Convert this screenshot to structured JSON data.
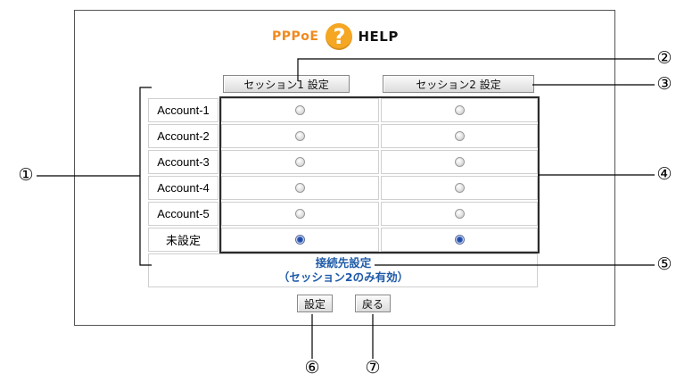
{
  "title": {
    "prefix": "PPPoE",
    "icon": "question-icon",
    "icon_glyph": "?",
    "suffix": "HELP"
  },
  "buttons": {
    "session1": "セッション1 設定",
    "session2": "セッション2 設定",
    "set": "設定",
    "back": "戻る"
  },
  "accounts": [
    {
      "label": "Account-1",
      "s1_selected": false,
      "s2_selected": false
    },
    {
      "label": "Account-2",
      "s1_selected": false,
      "s2_selected": false
    },
    {
      "label": "Account-3",
      "s1_selected": false,
      "s2_selected": false
    },
    {
      "label": "Account-4",
      "s1_selected": false,
      "s2_selected": false
    },
    {
      "label": "Account-5",
      "s1_selected": false,
      "s2_selected": false
    },
    {
      "label": "未設定",
      "s1_selected": true,
      "s2_selected": true
    }
  ],
  "destination": {
    "line1": "接続先設定",
    "line2": "（セッション2のみ有効）"
  },
  "callouts": [
    "①",
    "②",
    "③",
    "④",
    "⑤",
    "⑥",
    "⑦"
  ],
  "colors": {
    "title_orange": "#f08a1e",
    "help_icon": "#f5a623",
    "section_blue": "#1e5aa8",
    "radio_selected": "#2b5bbf"
  }
}
